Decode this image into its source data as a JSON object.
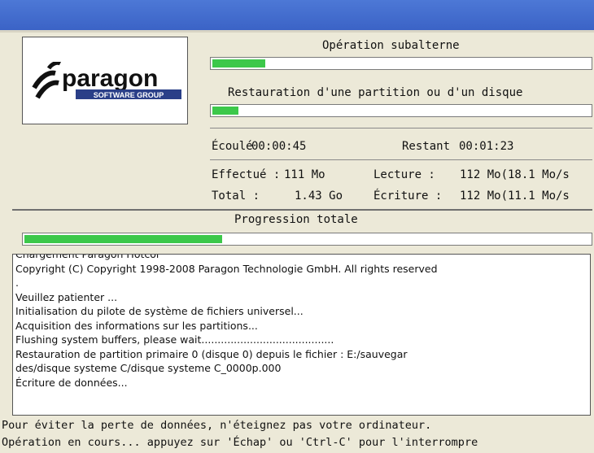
{
  "logo": {
    "brand": "paragon",
    "tagline": "SOFTWARE GROUP"
  },
  "sub_operation": {
    "title": "Opération subalterne",
    "progress": 0.14
  },
  "task": {
    "title": "Restauration d'une partition ou d'un disque",
    "progress": 0.07
  },
  "time": {
    "elapsed_label": "Écoulé",
    "elapsed": "00:00:45",
    "remaining_label": "Restant",
    "remaining": "00:01:23"
  },
  "stats": {
    "done_label": "Effectué :",
    "done": "111 Mo",
    "read_label": "Lecture : ",
    "read": "112 Mo(18.1 Mo/s",
    "total_label": "Total : ",
    "total": "1.43 Go",
    "write_label": "Écriture :",
    "write": "112 Mo(11.1 Mo/s"
  },
  "overall": {
    "title": "Progression totale",
    "progress": 0.35
  },
  "log_lines": [
    "Chargement Paragon Hotcor",
    "Copyright (C) Copyright 1998-2008 Paragon Technologie GmbH. All rights reserved",
    ".",
    "Veuillez patienter ...",
    "Initialisation du pilote de système de fichiers universel...",
    "Acquisition des informations sur les partitions...",
    "Flushing system buffers, please wait.........................................",
    "Restauration de partition primaire 0 (disque 0) depuis le fichier : E:/sauvegar",
    "des/disque systeme C/disque systeme C_0000p.000",
    "Écriture de données..."
  ],
  "footer": {
    "line1": "Pour éviter la perte de données, n'éteignez pas votre ordinateur.",
    "line2": "Opération en cours... appuyez sur 'Échap' ou 'Ctrl-C' pour l'interrompre"
  },
  "colors": {
    "progress_fill": "#3cc84a",
    "titlebar": "#4470d0"
  }
}
